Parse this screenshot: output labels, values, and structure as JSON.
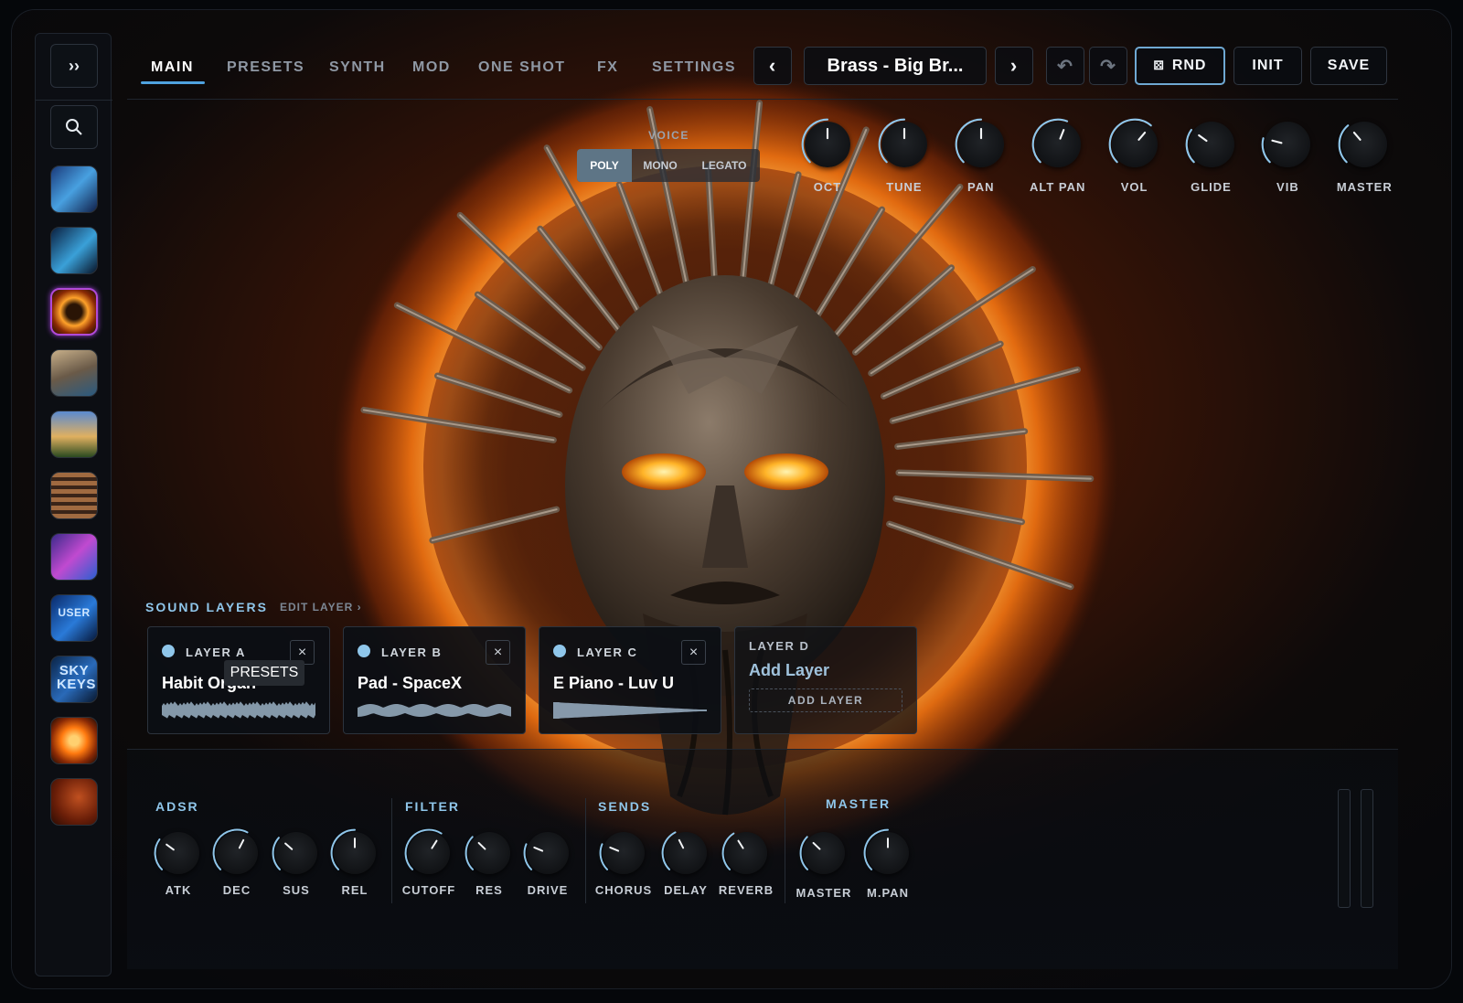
{
  "nav": {
    "tabs": [
      "MAIN",
      "PRESETS",
      "SYNTH",
      "MOD",
      "ONE SHOT",
      "FX",
      "SETTINGS"
    ],
    "active_tab": "MAIN"
  },
  "toolbar": {
    "prev_symbol": "‹",
    "preset_name": "Brass - Big Br...",
    "next_symbol": "›",
    "undo_symbol": "↶",
    "redo_symbol": "↷",
    "rnd_icon": "⚄",
    "rnd_label": "RND",
    "init_label": "INIT",
    "save_label": "SAVE"
  },
  "sidebar": {
    "expand_symbol": "››",
    "search_symbol": "⌕",
    "thumbs": [
      {
        "name": "library-thumb-1",
        "text": ""
      },
      {
        "name": "library-thumb-2",
        "text": ""
      },
      {
        "name": "library-thumb-3",
        "text": "",
        "selected": true
      },
      {
        "name": "library-thumb-4",
        "text": ""
      },
      {
        "name": "library-thumb-5",
        "text": ""
      },
      {
        "name": "library-thumb-6",
        "text": ""
      },
      {
        "name": "library-thumb-7",
        "text": ""
      },
      {
        "name": "library-thumb-user",
        "text": "USER"
      },
      {
        "name": "library-thumb-sky-keys",
        "text": "SKY KEYS"
      },
      {
        "name": "library-thumb-10",
        "text": ""
      },
      {
        "name": "library-thumb-11",
        "text": ""
      }
    ]
  },
  "voice": {
    "label": "VOICE",
    "modes": [
      "POLY",
      "MONO",
      "LEGATO"
    ],
    "active": "POLY"
  },
  "top_knobs": [
    {
      "label": "OCT",
      "value": 0.5
    },
    {
      "label": "TUNE",
      "value": 0.5
    },
    {
      "label": "PAN",
      "value": 0.5
    },
    {
      "label": "ALT PAN",
      "value": 0.58
    },
    {
      "label": "VOL",
      "value": 0.65
    },
    {
      "label": "GLIDE",
      "value": 0.3
    },
    {
      "label": "VIB",
      "value": 0.22
    },
    {
      "label": "MASTER",
      "value": 0.35
    }
  ],
  "sound_layers": {
    "title": "SOUND LAYERS",
    "edit_label": "EDIT LAYER ›",
    "layers": [
      {
        "label": "LAYER A",
        "preset": "Habit Organ",
        "close": "×"
      },
      {
        "label": "LAYER B",
        "preset": "Pad - SpaceX",
        "close": "×"
      },
      {
        "label": "LAYER C",
        "preset": "E Piano - Luv U",
        "close": "×"
      }
    ],
    "empty_layer": {
      "label": "LAYER D",
      "title": "Add Layer",
      "button": "ADD LAYER"
    },
    "tooltip": "PRESETS"
  },
  "bottom": {
    "adsr": {
      "title": "ADSR",
      "knobs": [
        {
          "label": "ATK",
          "value": 0.3
        },
        {
          "label": "DEC",
          "value": 0.6
        },
        {
          "label": "SUS",
          "value": 0.32
        },
        {
          "label": "REL",
          "value": 0.5
        }
      ]
    },
    "filter": {
      "title": "FILTER",
      "knobs": [
        {
          "label": "CUTOFF",
          "value": 0.62
        },
        {
          "label": "RES",
          "value": 0.33
        },
        {
          "label": "DRIVE",
          "value": 0.25
        }
      ]
    },
    "sends": {
      "title": "SENDS",
      "knobs": [
        {
          "label": "CHORUS",
          "value": 0.25
        },
        {
          "label": "DELAY",
          "value": 0.4
        },
        {
          "label": "REVERB",
          "value": 0.38
        }
      ]
    },
    "master": {
      "title": "MASTER",
      "knobs": [
        {
          "label": "MASTER",
          "value": 0.33
        },
        {
          "label": "M.PAN",
          "value": 0.5
        }
      ]
    }
  },
  "colors": {
    "accent": "#8fc6ea",
    "tab_underline": "#4fa3e0",
    "selected_thumb": "#b04ad8",
    "knob_arc": "#8fc6ea"
  }
}
